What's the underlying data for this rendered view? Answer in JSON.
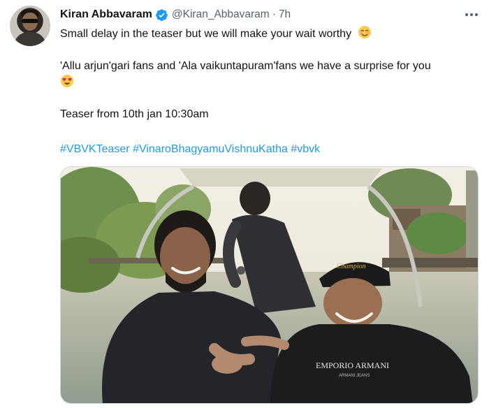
{
  "tweet": {
    "author_name": "Kiran Abbavaram",
    "handle": "@Kiran_Abbavaram",
    "separator": "·",
    "time": "7h",
    "line1": "Small delay in the teaser but we will make your wait worthy",
    "line2": "'Allu arjun'gari fans and 'Ala vaikuntapuram'fans we have a surprise for you",
    "line3": "Teaser from 10th jan 10:30am",
    "hashtags": [
      "#VBVKTeaser",
      "#VinaroBhagyamuVishnuKatha",
      "#vbvk"
    ],
    "emoji1": "smiling-face-with-blush-emoji",
    "emoji2": "heart-eyes-emoji"
  },
  "media": {
    "cap_text": "Champion",
    "shirt_text": "EMPORIO ARMANI",
    "shirt_subtext": "ARMANI JEANS"
  },
  "colors": {
    "link": "#1d9bf0",
    "verified": "#1d9bf0",
    "secondary_text": "#536471"
  }
}
